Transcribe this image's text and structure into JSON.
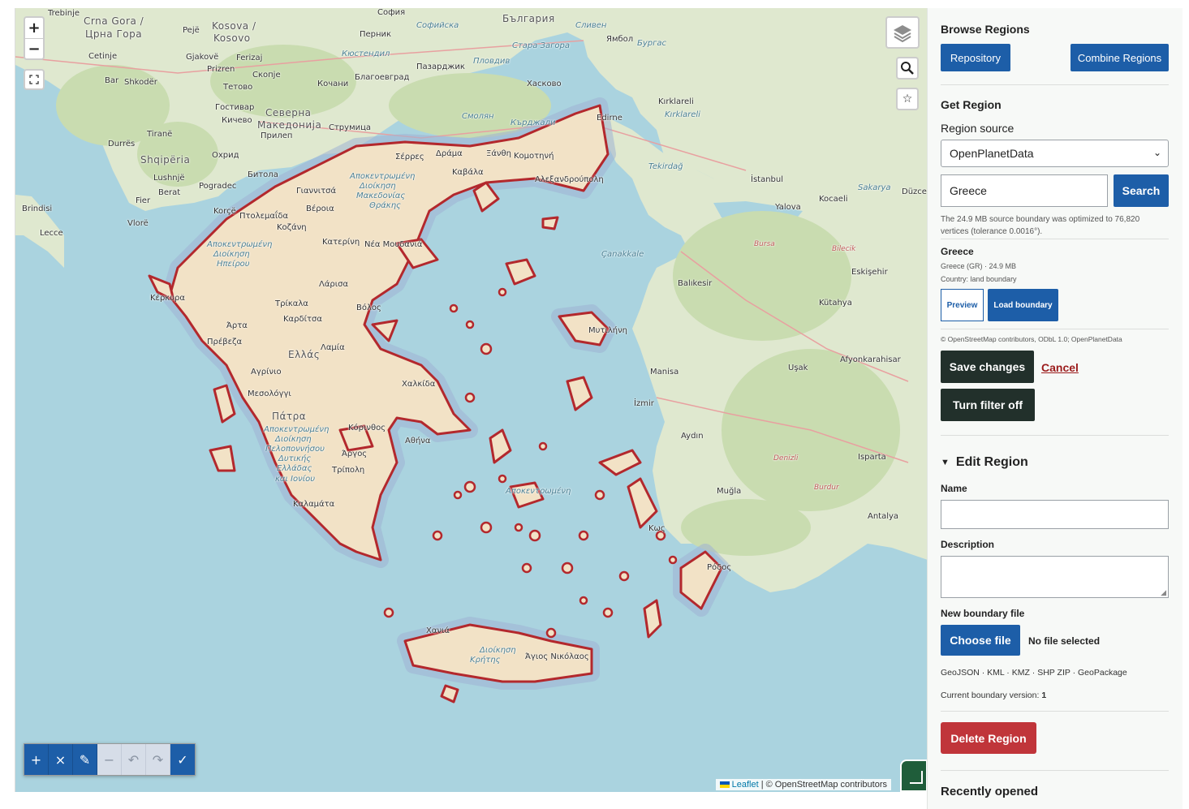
{
  "map": {
    "zoom_in": "+",
    "zoom_out": "−",
    "labels": [
      {
        "text": "Trebinje"
      },
      {
        "text": "Crna Gora /"
      },
      {
        "text": "Црна Гора"
      },
      {
        "text": "Pejë"
      },
      {
        "text": "Kosova /"
      },
      {
        "text": "Kosovo"
      },
      {
        "text": "София"
      },
      {
        "text": "Софийска"
      },
      {
        "text": "Перник"
      },
      {
        "text": "Кюстендил"
      },
      {
        "text": "България"
      },
      {
        "text": "Сливен"
      },
      {
        "text": "Стара Загора"
      },
      {
        "text": "Ямбол"
      },
      {
        "text": "Бургас"
      },
      {
        "text": "Пловдив"
      },
      {
        "text": "Пазарджик"
      },
      {
        "text": "Хасково"
      },
      {
        "text": "Кърджали"
      },
      {
        "text": "Благоевград"
      },
      {
        "text": "Смолян"
      },
      {
        "text": "Кирклареli"
      },
      {
        "text": "Kırklareli"
      },
      {
        "text": "Shkodër"
      },
      {
        "text": "Cetinje"
      },
      {
        "text": "Bar"
      },
      {
        "text": "Gjakovë"
      },
      {
        "text": "Prizren"
      },
      {
        "text": "Ferizaj"
      },
      {
        "text": "Скопје"
      },
      {
        "text": "Тетово"
      },
      {
        "text": "Кочани"
      },
      {
        "text": "Гостивар"
      },
      {
        "text": "Кичево"
      },
      {
        "text": "Северна"
      },
      {
        "text": "Македонија"
      },
      {
        "text": "Прилеп"
      },
      {
        "text": "Струмица"
      },
      {
        "text": "Tiranë"
      },
      {
        "text": "Durrës"
      },
      {
        "text": "Shqipëria"
      },
      {
        "text": "Lushnjë"
      },
      {
        "text": "Berat"
      },
      {
        "text": "Охрид"
      },
      {
        "text": "Битола"
      },
      {
        "text": "Pogradec"
      },
      {
        "text": "Korçë"
      },
      {
        "text": "Brindisi"
      },
      {
        "text": "Lecce"
      },
      {
        "text": "Vlorë"
      },
      {
        "text": "Fier"
      },
      {
        "text": "Edirne"
      },
      {
        "text": "Tekirdağ"
      },
      {
        "text": "İstanbul"
      },
      {
        "text": "Kocaeli"
      },
      {
        "text": "Sakarya"
      },
      {
        "text": "Düzce"
      },
      {
        "text": "Yalova"
      },
      {
        "text": "Bursa"
      },
      {
        "text": "Çanakkale"
      },
      {
        "text": "Bilecik"
      },
      {
        "text": "Balıkesir"
      },
      {
        "text": "Eskişehir"
      },
      {
        "text": "Kütahya"
      },
      {
        "text": "Manisa"
      },
      {
        "text": "İzmir"
      },
      {
        "text": "Uşak"
      },
      {
        "text": "Afyonkarahisar"
      },
      {
        "text": "Aydın"
      },
      {
        "text": "Denizli"
      },
      {
        "text": "Isparta"
      },
      {
        "text": "Burdur"
      },
      {
        "text": "Muğla"
      },
      {
        "text": "Antalya"
      },
      {
        "text": "Σέρρες"
      },
      {
        "text": "Δράμα"
      },
      {
        "text": "Ξάνθη"
      },
      {
        "text": "Κομοτηνή"
      },
      {
        "text": "Καβάλα"
      },
      {
        "text": "Αλεξανδρούπολη"
      },
      {
        "text": "Αποκεντρωμένη"
      },
      {
        "text": "Διοίκηση"
      },
      {
        "text": "Μακεδονίας"
      },
      {
        "text": "Θράκης"
      },
      {
        "text": "Γιαννιτσά"
      },
      {
        "text": "Πτολεμαΐδα"
      },
      {
        "text": "Βέροια"
      },
      {
        "text": "Κοζάνη"
      },
      {
        "text": "Κατερίνη"
      },
      {
        "text": "Νέα Μουδανιά"
      },
      {
        "text": "Ηπείρου"
      },
      {
        "text": "Λάρισα"
      },
      {
        "text": "Τρίκαλα"
      },
      {
        "text": "Καρδίτσα"
      },
      {
        "text": "Βόλος"
      },
      {
        "text": "Άρτα"
      },
      {
        "text": "Πρέβεζα"
      },
      {
        "text": "Λαμία"
      },
      {
        "text": "Ελλάς"
      },
      {
        "text": "Αγρίνιο"
      },
      {
        "text": "Μεσολόγγι"
      },
      {
        "text": "Χαλκίδα"
      },
      {
        "text": "Πάτρα"
      },
      {
        "text": "Αθήνα"
      },
      {
        "text": "Κόρινθος"
      },
      {
        "text": "Άργος"
      },
      {
        "text": "Τρίπολη"
      },
      {
        "text": "Πελοποννήσου"
      },
      {
        "text": "Δυτικής"
      },
      {
        "text": "Ελλάδας"
      },
      {
        "text": "και Ιονίου"
      },
      {
        "text": "Καλαμάτα"
      },
      {
        "text": "Κέρκυρα"
      },
      {
        "text": "Μυτιλήνη"
      },
      {
        "text": "Ρόδος"
      },
      {
        "text": "Κως"
      },
      {
        "text": "Χανιά"
      },
      {
        "text": "Κρήτης"
      },
      {
        "text": "Άγιος Νικόλαος"
      }
    ],
    "attribution_leaflet": "Leaflet",
    "attribution_text": "| © OpenStreetMap contributors",
    "colors": {
      "sea": "#aad3df",
      "land": "#dfe8cf",
      "forest": "#c9dcb0",
      "region_fill": "#f2e2c6",
      "region_border": "#b3282d",
      "halo": "#9eb3d4"
    },
    "draw_toolbar": [
      {
        "name": "draw-polygon",
        "icon": "+",
        "active": true
      },
      {
        "name": "delete",
        "icon": "×",
        "active": true
      },
      {
        "name": "edit",
        "icon": "✎",
        "active": true
      },
      {
        "name": "remove-vertex",
        "icon": "−",
        "active": false
      },
      {
        "name": "undo",
        "icon": "↶",
        "active": false
      },
      {
        "name": "redo",
        "icon": "↷",
        "active": false
      },
      {
        "name": "finish",
        "icon": "✓",
        "active": true
      }
    ]
  },
  "sidebar": {
    "browse_title": "Browse Regions",
    "repository_button": "Repository",
    "combine_button": "Combine Regions",
    "get_title": "Get Region",
    "region_source_label": "Region source",
    "region_source_value": "OpenPlanetData",
    "search_value": "Greece",
    "search_button": "Search",
    "optimize_note": "The 24.9 MB source boundary was optimized to 76,820 vertices (tolerance 0.0016°).",
    "result_name": "Greece",
    "result_meta": "Greece (GR) · 24.9 MB",
    "result_type": "Country: land boundary",
    "preview_button": "Preview",
    "load_button": "Load boundary",
    "data_attribution": "© OpenStreetMap contributors, ODbL 1.0; OpenPlanetData",
    "save_button": "Save changes",
    "cancel_link": "Cancel",
    "filter_button": "Turn filter off",
    "edit_title": "Edit Region",
    "name_label": "Name",
    "description_label": "Description",
    "boundary_file_label": "New boundary file",
    "choose_file_button": "Choose file",
    "no_file_text": "No file selected",
    "formats": "GeoJSON · KML · KMZ · SHP ZIP · GeoPackage",
    "boundary_version_label": "Current boundary version:",
    "boundary_version_value": "1",
    "delete_button": "Delete Region",
    "recent_title": "Recently opened"
  }
}
